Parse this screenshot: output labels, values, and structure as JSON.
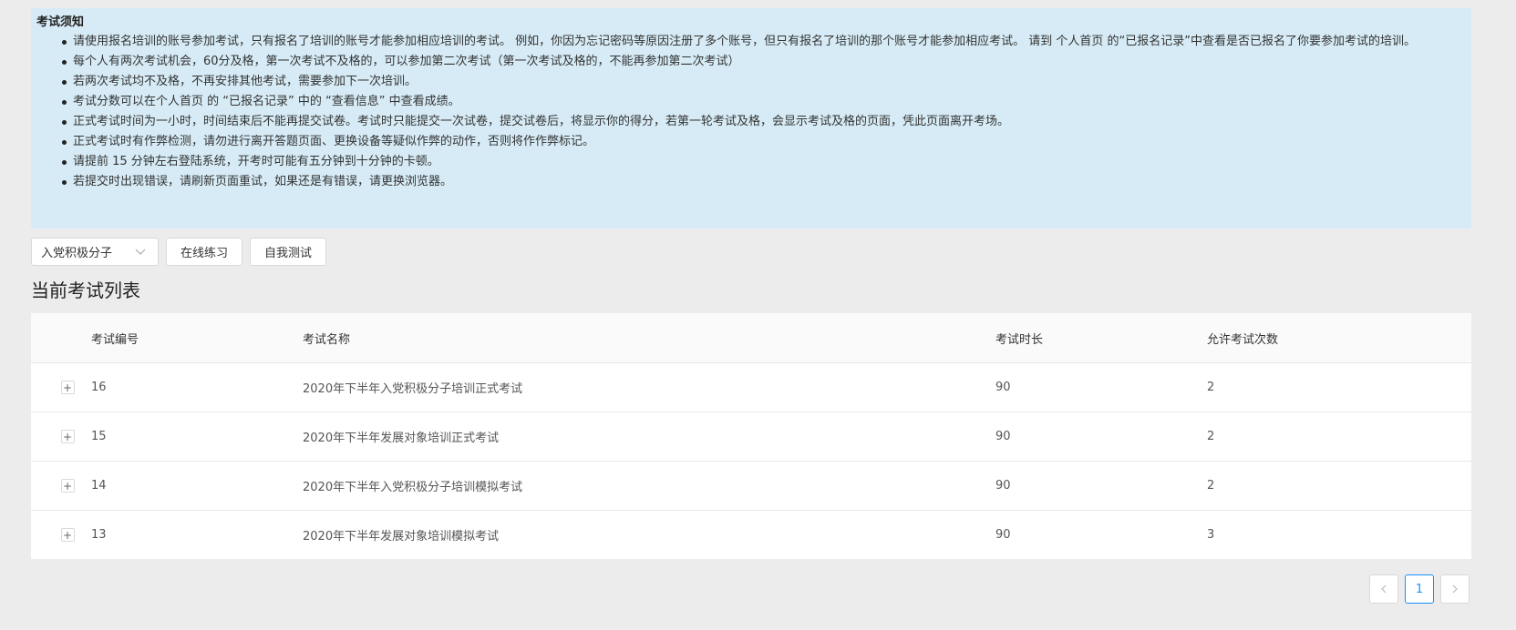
{
  "notice": {
    "title": "考试须知",
    "items": [
      "请使用报名培训的账号参加考试，只有报名了培训的账号才能参加相应培训的考试。 例如，你因为忘记密码等原因注册了多个账号，但只有报名了培训的那个账号才能参加相应考试。 请到 个人首页 的“已报名记录”中查看是否已报名了你要参加考试的培训。",
      "每个人有两次考试机会，60分及格，第一次考试不及格的，可以参加第二次考试（第一次考试及格的，不能再参加第二次考试）",
      "若两次考试均不及格，不再安排其他考试，需要参加下一次培训。",
      "考试分数可以在个人首页 的 “已报名记录” 中的 “查看信息” 中查看成绩。",
      "正式考试时间为一小时，时间结束后不能再提交试卷。考试时只能提交一次试卷，提交试卷后，将显示你的得分，若第一轮考试及格，会显示考试及格的页面，凭此页面离开考场。",
      "正式考试时有作弊检测，请勿进行离开答题页面、更换设备等疑似作弊的动作，否则将作作弊标记。",
      "请提前 15 分钟左右登陆系统，开考时可能有五分钟到十分钟的卡顿。",
      "若提交时出现错误，请刷新页面重试，如果还是有错误，请更换浏览器。"
    ]
  },
  "toolbar": {
    "select_value": "入党积极分子",
    "online_practice_label": "在线练习",
    "self_test_label": "自我测试"
  },
  "section_title": "当前考试列表",
  "table": {
    "headers": [
      "考试编号",
      "考试名称",
      "考试时长",
      "允许考试次数"
    ],
    "expand_symbol": "+",
    "rows": [
      {
        "id": "16",
        "name": "2020年下半年入党积极分子培训正式考试",
        "duration": "90",
        "attempts": "2"
      },
      {
        "id": "15",
        "name": "2020年下半年发展对象培训正式考试",
        "duration": "90",
        "attempts": "2"
      },
      {
        "id": "14",
        "name": "2020年下半年入党积极分子培训模拟考试",
        "duration": "90",
        "attempts": "2"
      },
      {
        "id": "13",
        "name": "2020年下半年发展对象培训模拟考试",
        "duration": "90",
        "attempts": "3"
      }
    ]
  },
  "pagination": {
    "current_page": "1",
    "prev_icon": "chevron-left-icon",
    "next_icon": "chevron-right-icon"
  },
  "colors": {
    "notice_background": "#d6ebf5",
    "accent": "#1890ff",
    "page_background": "#ececec"
  }
}
